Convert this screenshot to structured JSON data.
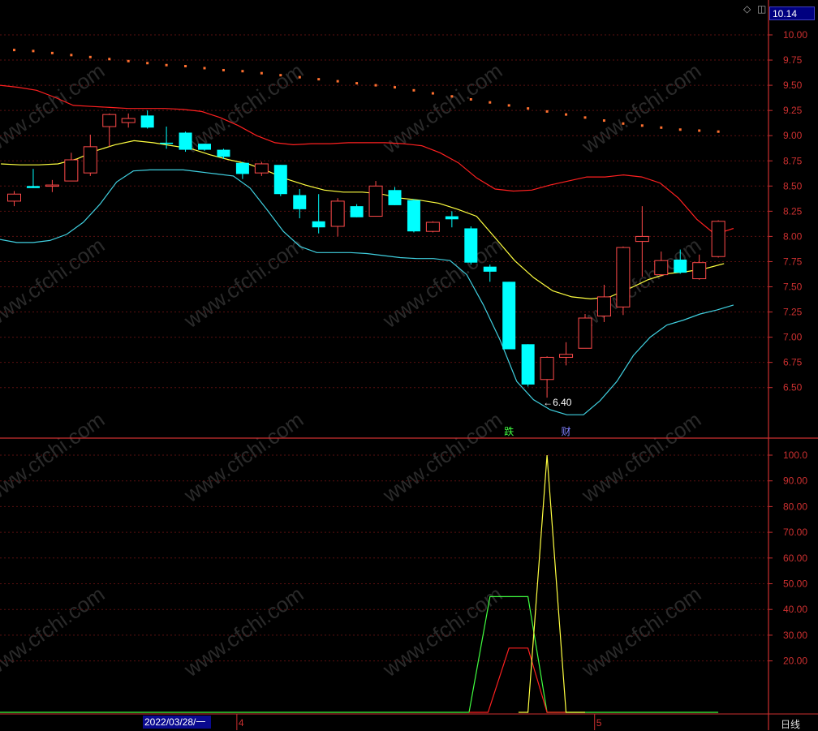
{
  "header": {
    "current_price": "10.14",
    "icons": [
      "diamond-icon",
      "window-icon"
    ]
  },
  "footer": {
    "date_label": "2022/03/28/一",
    "month_marks": [
      {
        "label": "4",
        "x_index": 11.7
      },
      {
        "label": "5",
        "x_index": 30.5
      }
    ],
    "period": "日线"
  },
  "watermark_text": "www.cfchi.com",
  "colors": {
    "up": "#ff4a4a",
    "down": "#00ffff",
    "ma": "#ffff40",
    "upper_band": "#ff2020",
    "lower_band": "#40d0e0",
    "sar": "#ff7030",
    "axis": "#cc3030",
    "green_line": "#40ff40",
    "red_line": "#ff2020",
    "yellow_line": "#ffff40"
  },
  "chart_data": [
    {
      "type": "candlestick",
      "yticks": [
        10.0,
        9.75,
        9.5,
        9.25,
        9.0,
        8.75,
        8.5,
        8.25,
        8.0,
        7.75,
        7.5,
        7.25,
        7.0,
        6.75,
        6.5
      ],
      "ylim": [
        6.25,
        10.2
      ],
      "grid": true,
      "candles": [
        {
          "o": 8.35,
          "h": 8.45,
          "l": 8.3,
          "c": 8.42
        },
        {
          "o": 8.5,
          "h": 8.67,
          "l": 8.48,
          "c": 8.48
        },
        {
          "o": 8.5,
          "h": 8.56,
          "l": 8.44,
          "c": 8.51
        },
        {
          "o": 8.55,
          "h": 8.83,
          "l": 8.55,
          "c": 8.76
        },
        {
          "o": 8.63,
          "h": 9.01,
          "l": 8.6,
          "c": 8.89
        },
        {
          "o": 9.09,
          "h": 9.22,
          "l": 8.89,
          "c": 9.21
        },
        {
          "o": 9.13,
          "h": 9.22,
          "l": 9.08,
          "c": 9.17
        },
        {
          "o": 9.2,
          "h": 9.25,
          "l": 9.07,
          "c": 9.08
        },
        {
          "o": 8.93,
          "h": 9.09,
          "l": 8.87,
          "c": 8.92
        },
        {
          "o": 9.03,
          "h": 9.04,
          "l": 8.84,
          "c": 8.86
        },
        {
          "o": 8.92,
          "h": 8.92,
          "l": 8.85,
          "c": 8.86
        },
        {
          "o": 8.86,
          "h": 8.87,
          "l": 8.77,
          "c": 8.79
        },
        {
          "o": 8.73,
          "h": 8.74,
          "l": 8.57,
          "c": 8.62
        },
        {
          "o": 8.63,
          "h": 8.74,
          "l": 8.6,
          "c": 8.72
        },
        {
          "o": 8.71,
          "h": 8.71,
          "l": 8.4,
          "c": 8.42
        },
        {
          "o": 8.41,
          "h": 8.47,
          "l": 8.18,
          "c": 8.27
        },
        {
          "o": 8.15,
          "h": 8.42,
          "l": 8.03,
          "c": 8.09
        },
        {
          "o": 8.1,
          "h": 8.38,
          "l": 8.0,
          "c": 8.35
        },
        {
          "o": 8.3,
          "h": 8.32,
          "l": 8.19,
          "c": 8.19
        },
        {
          "o": 8.2,
          "h": 8.55,
          "l": 8.2,
          "c": 8.5
        },
        {
          "o": 8.46,
          "h": 8.49,
          "l": 8.31,
          "c": 8.31
        },
        {
          "o": 8.36,
          "h": 8.37,
          "l": 8.04,
          "c": 8.05
        },
        {
          "o": 8.05,
          "h": 8.15,
          "l": 8.04,
          "c": 8.14
        },
        {
          "o": 8.2,
          "h": 8.25,
          "l": 8.09,
          "c": 8.17
        },
        {
          "o": 8.08,
          "h": 8.1,
          "l": 7.72,
          "c": 7.74
        },
        {
          "o": 7.7,
          "h": 7.72,
          "l": 7.55,
          "c": 7.65
        },
        {
          "o": 7.55,
          "h": 7.55,
          "l": 6.88,
          "c": 6.88
        },
        {
          "o": 6.93,
          "h": 6.93,
          "l": 6.51,
          "c": 6.53
        },
        {
          "o": 6.58,
          "h": 6.81,
          "l": 6.4,
          "c": 6.8
        },
        {
          "o": 6.8,
          "h": 6.95,
          "l": 6.72,
          "c": 6.83
        },
        {
          "o": 6.89,
          "h": 7.23,
          "l": 6.89,
          "c": 7.19
        },
        {
          "o": 7.21,
          "h": 7.52,
          "l": 7.15,
          "c": 7.4
        },
        {
          "o": 7.3,
          "h": 7.9,
          "l": 7.22,
          "c": 7.89
        },
        {
          "o": 7.95,
          "h": 8.3,
          "l": 7.6,
          "c": 8.0
        },
        {
          "o": 7.62,
          "h": 7.85,
          "l": 7.6,
          "c": 7.76
        },
        {
          "o": 7.77,
          "h": 7.87,
          "l": 7.63,
          "c": 7.64
        },
        {
          "o": 7.58,
          "h": 7.82,
          "l": 7.57,
          "c": 7.74
        },
        {
          "o": 7.8,
          "h": 8.16,
          "l": 7.79,
          "c": 8.15
        }
      ],
      "ma": [
        8.72,
        8.71,
        8.71,
        8.72,
        8.77,
        8.85,
        8.91,
        8.95,
        8.93,
        8.9,
        8.87,
        8.81,
        8.76,
        8.72,
        8.65,
        8.57,
        8.51,
        8.46,
        8.44,
        8.44,
        8.42,
        8.38,
        8.36,
        8.33,
        8.27,
        8.2,
        7.98,
        7.76,
        7.59,
        7.46,
        7.4,
        7.38,
        7.4,
        7.48,
        7.57,
        7.63,
        7.65,
        7.68,
        7.73
      ],
      "upper_band": [
        9.5,
        9.48,
        9.45,
        9.38,
        9.3,
        9.29,
        9.28,
        9.27,
        9.27,
        9.27,
        9.26,
        9.24,
        9.18,
        9.1,
        9.0,
        8.93,
        8.91,
        8.92,
        8.92,
        8.93,
        8.93,
        8.93,
        8.92,
        8.9,
        8.83,
        8.73,
        8.58,
        8.47,
        8.45,
        8.46,
        8.51,
        8.55,
        8.59,
        8.59,
        8.61,
        8.59,
        8.53,
        8.38,
        8.17,
        8.02,
        8.08
      ],
      "lower_band": [
        7.97,
        7.94,
        7.94,
        7.96,
        8.02,
        8.14,
        8.32,
        8.54,
        8.65,
        8.66,
        8.66,
        8.66,
        8.64,
        8.62,
        8.6,
        8.48,
        8.27,
        8.05,
        7.9,
        7.84,
        7.84,
        7.84,
        7.83,
        7.81,
        7.79,
        7.78,
        7.78,
        7.76,
        7.62,
        7.32,
        6.97,
        6.56,
        6.38,
        6.28,
        6.23,
        6.23,
        6.37,
        6.56,
        6.82,
        7.0,
        7.12,
        7.17,
        7.23,
        7.27,
        7.32
      ],
      "sar": [
        9.85,
        9.84,
        9.82,
        9.8,
        9.78,
        9.76,
        9.74,
        9.72,
        9.7,
        9.69,
        9.67,
        9.65,
        9.64,
        9.62,
        9.6,
        9.58,
        9.56,
        9.54,
        9.52,
        9.5,
        9.48,
        9.45,
        9.42,
        9.39,
        9.36,
        9.33,
        9.3,
        9.27,
        9.24,
        9.21,
        9.18,
        9.15,
        9.12,
        9.1,
        9.08,
        9.06,
        9.05,
        9.04
      ],
      "annotations": [
        {
          "text": "←6.40",
          "at_index": 28
        },
        {
          "text": "跌",
          "at_index": 26,
          "color": "#40ff40"
        },
        {
          "text": "财",
          "at_index": 29,
          "color": "#8080ff"
        }
      ]
    },
    {
      "type": "line",
      "yticks": [
        100.0,
        90.0,
        80.0,
        70.0,
        60.0,
        50.0,
        40.0,
        30.0,
        20.0
      ],
      "ylim": [
        0,
        105
      ],
      "grid": true,
      "series": [
        {
          "color": "#40ff40",
          "points": [
            [
              -2,
              0
            ],
            [
              23.9,
              0
            ],
            [
              25.0,
              45
            ],
            [
              27.0,
              45
            ],
            [
              28.0,
              0
            ],
            [
              37,
              0
            ]
          ]
        },
        {
          "color": "#ff2020",
          "points": [
            [
              23.9,
              0
            ],
            [
              24.9,
              0
            ],
            [
              26.0,
              25
            ],
            [
              27.0,
              25
            ],
            [
              28.0,
              0
            ],
            [
              29,
              0
            ]
          ]
        },
        {
          "color": "#ffff40",
          "points": [
            [
              26.5,
              0
            ],
            [
              27.0,
              0
            ],
            [
              28.0,
              100
            ],
            [
              29.0,
              0
            ],
            [
              30,
              0
            ]
          ]
        }
      ]
    }
  ]
}
